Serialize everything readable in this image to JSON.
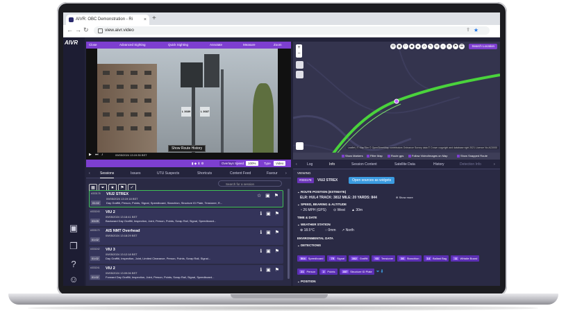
{
  "browser": {
    "tab_title": "AIVR: OBC Demonstration - Ri",
    "new_tab": "+",
    "url": "view.aivr.video"
  },
  "app": {
    "logo": "AIVR",
    "video_toolbar": [
      "Close",
      "Advanced Sighting",
      "Quick Sighting",
      "Annotate",
      "Measure",
      "Zoom"
    ],
    "route_history_button": "Show Route History",
    "video_timestamp": "09/05/2024 13:19:35 BST",
    "signal_plates": [
      "L 3689",
      "L 3687"
    ],
    "video_controls": {
      "overlays": "Overlays",
      "speed_label": "Speed",
      "speed_value": "100%",
      "type_label": "Type",
      "type_value": "Video"
    },
    "map": {
      "search_location": "Search Location",
      "zoom_in": "+",
      "zoom_out": "−",
      "attribution": "Leaflet | © MapTiler © OpenStreetMap contributors Ordnance Survey data © Crown copyright and database right 2021 Licence No AC0000",
      "checkboxes": [
        "Show Markers",
        "Filter Map",
        "Route gps",
        "Follow Video/Images on Map",
        "Show Snapped Route"
      ]
    },
    "session_tabs": [
      "Sessions",
      "Issues",
      "UTU Suspects",
      "Shortcuts",
      "Content Feed",
      "Favour"
    ],
    "session_search_placeholder": "Search for a session",
    "sessions": [
      {
        "title": "VIU2 STREX",
        "id": "#333178",
        "duration": "01:02",
        "date": "09/05/2024 13:19:18 BST",
        "tags": "Day   Graffiti, Person, Points, Signal, Speedboard, Stanchion, Structure ID Plate, Tensioner, R..."
      },
      {
        "title": "VIU 2",
        "id": "#333243",
        "duration": "03:09",
        "date": "09/05/2024 13:18:41 BST",
        "tags": "Backward   Day   Graffiti, Inspection, Joint, Person, Points, Scrap Rail, Signal, Speedboard..."
      },
      {
        "title": "AIS NMT Overhead",
        "id": "#333170",
        "duration": "01:02",
        "date": "09/05/2024 13:18:29 BST",
        "tags": ""
      },
      {
        "title": "VIU 3",
        "id": "#333242",
        "duration": "01:02",
        "date": "09/05/2024 13:12:18 BST",
        "tags": "Day   Graffiti, Inspection, Joint, Limited Clearance, Person, Points, Scrap Rail, Signal..."
      },
      {
        "title": "VIU 2",
        "id": "#333241",
        "duration": "01:02",
        "date": "09/05/2024 13:09:06 BST",
        "tags": "Forward   Day   Graffiti, Inspection, Joint, Person, Points, Scrap Rail, Signal, Speedboard..."
      }
    ],
    "detail_tabs": [
      "Log",
      "Info",
      "Session Content",
      "Satellite Data",
      "History",
      "Detection Info"
    ],
    "details": {
      "viewing_label": "VIEWING",
      "viewing_id": "#333178",
      "viewing_name": "VIU2 STREX",
      "open_sources": "Open sources as widgets",
      "route_position_label": "ROUTE POSITION (ESTIMATE)",
      "route_position": "ELR: HUL4   TRACK: 3812   MILE: 20   YARDS: 844",
      "show_more": "Show more",
      "speed_label": "SPEED, BEARING & ALTITUDE",
      "speed": "26 MPH (GPS)",
      "bearing": "West",
      "altitude": "30m",
      "time_label": "TIME & DATE",
      "weather_label": "WEATHER STATION",
      "temperature": "18.5°C",
      "rain": "0mm",
      "wind": "North",
      "env_label": "ENVIRONMENTAL DATA",
      "detections_label": "DETECTIONS",
      "detections": [
        {
          "count": "504",
          "name": "Speedboard"
        },
        {
          "count": "75",
          "name": "Signal"
        },
        {
          "count": "342",
          "name": "Graffiti"
        },
        {
          "count": "63",
          "name": "Tensioner"
        },
        {
          "count": "36",
          "name": "Stanchion"
        },
        {
          "count": "14",
          "name": "Ballast Bag"
        },
        {
          "count": "11",
          "name": "Whistle Board"
        },
        {
          "count": "21",
          "name": "Person"
        },
        {
          "count": "2",
          "name": "Points"
        },
        {
          "count": "357",
          "name": "Structure ID Plate"
        }
      ],
      "position_label": "POSITION"
    }
  },
  "colors": {
    "accent": "#7d3fd0",
    "panel": "#2a2a44",
    "route": "#4ad33c",
    "selected": "#3fbf57"
  }
}
